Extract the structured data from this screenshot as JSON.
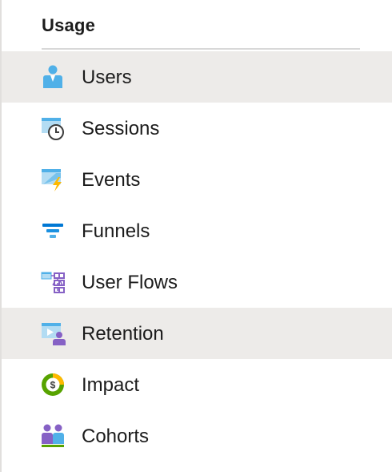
{
  "section": {
    "title": "Usage"
  },
  "menu": {
    "items": [
      {
        "label": "Users",
        "icon": "users-icon",
        "selected": true
      },
      {
        "label": "Sessions",
        "icon": "sessions-icon",
        "selected": false
      },
      {
        "label": "Events",
        "icon": "events-icon",
        "selected": false
      },
      {
        "label": "Funnels",
        "icon": "funnels-icon",
        "selected": false
      },
      {
        "label": "User Flows",
        "icon": "user-flows-icon",
        "selected": false
      },
      {
        "label": "Retention",
        "icon": "retention-icon",
        "selected": true
      },
      {
        "label": "Impact",
        "icon": "impact-icon",
        "selected": false
      },
      {
        "label": "Cohorts",
        "icon": "cohorts-icon",
        "selected": false
      }
    ]
  },
  "colors": {
    "selected_background": "#edebe9",
    "accent_blue": "#0078d4",
    "icon_light_blue": "#50b0e8",
    "icon_purple": "#8661c5",
    "icon_green": "#57a300",
    "icon_yellow": "#ffb900"
  }
}
